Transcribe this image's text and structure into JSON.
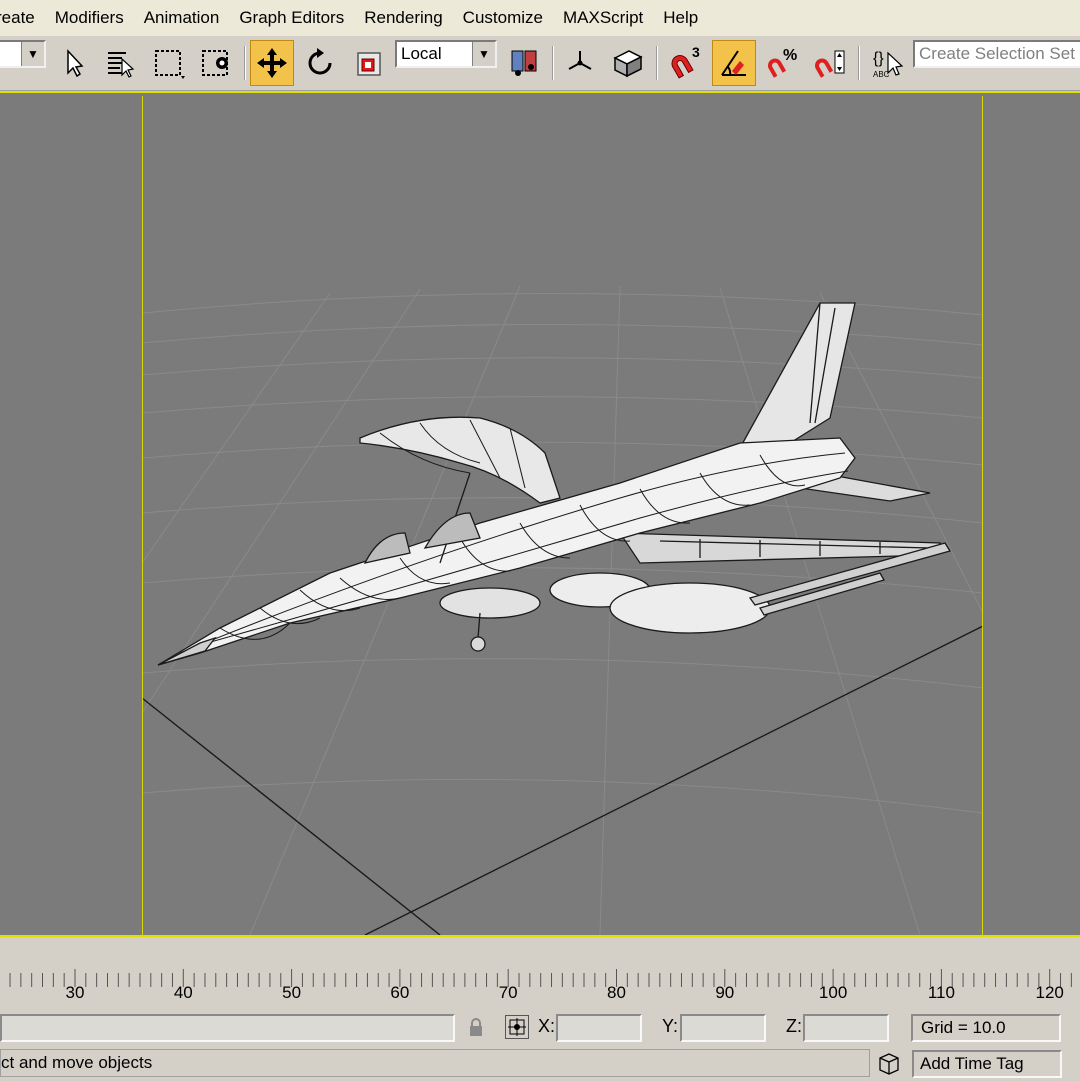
{
  "menu": [
    "reate",
    "Modifiers",
    "Animation",
    "Graph Editors",
    "Rendering",
    "Customize",
    "MAXScript",
    "Help"
  ],
  "toolbar": {
    "coord_system": "Local",
    "selection_set_placeholder": "Create Selection Set",
    "angle_snap_label": "3",
    "percent_snap_label": "%",
    "accent_color": "#f2c24a"
  },
  "timeline": {
    "ticks": [
      "30",
      "40",
      "50",
      "60",
      "70",
      "80",
      "90",
      "100",
      "110",
      "120"
    ]
  },
  "status": {
    "x_label": "X:",
    "y_label": "Y:",
    "z_label": "Z:",
    "grid_text": "Grid = 10.0",
    "prompt_text": "ct and move objects",
    "add_time_tag": "Add Time Tag"
  }
}
